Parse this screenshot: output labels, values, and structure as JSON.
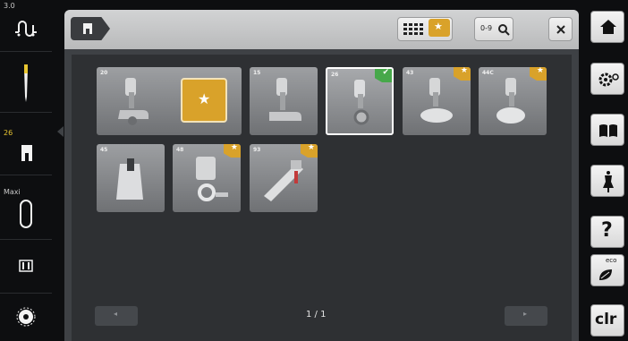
{
  "left_sidebar": {
    "top_value": "3.0",
    "foot_number": "26",
    "hoop_label": "Maxi"
  },
  "topbar": {
    "search_label": "0-9"
  },
  "tiles": [
    {
      "number": "20",
      "favorite": false,
      "selected": false
    },
    {
      "number": "",
      "favorite": false,
      "selected": false,
      "star_button": true
    },
    {
      "number": "15",
      "favorite": false,
      "selected": false
    },
    {
      "number": "26",
      "favorite": false,
      "selected": true
    },
    {
      "number": "43",
      "favorite": true,
      "selected": false
    },
    {
      "number": "44C",
      "favorite": true,
      "selected": false
    },
    {
      "number": "45",
      "favorite": false,
      "selected": false
    },
    {
      "number": "48",
      "favorite": true,
      "selected": false
    },
    {
      "number": "93",
      "favorite": true,
      "selected": false
    }
  ],
  "pagination": {
    "page": "1 / 1"
  },
  "right_sidebar": {
    "eco_label": "eco",
    "clr_label": "clr"
  },
  "colors": {
    "favorite_gold": "#d9a22a",
    "check_green": "#47a84a",
    "accent_yellow": "#e8c531"
  },
  "icons": [
    "tension-icon",
    "needle-icon",
    "presser-foot-icon",
    "hoop-icon",
    "feed-dog-icon",
    "bobbin-icon",
    "home-icon",
    "settings-icon",
    "tutorial-icon",
    "consultant-icon",
    "help-icon",
    "eco-icon",
    "favorite-star-icon",
    "grid-view-icon",
    "search-icon",
    "close-icon"
  ]
}
